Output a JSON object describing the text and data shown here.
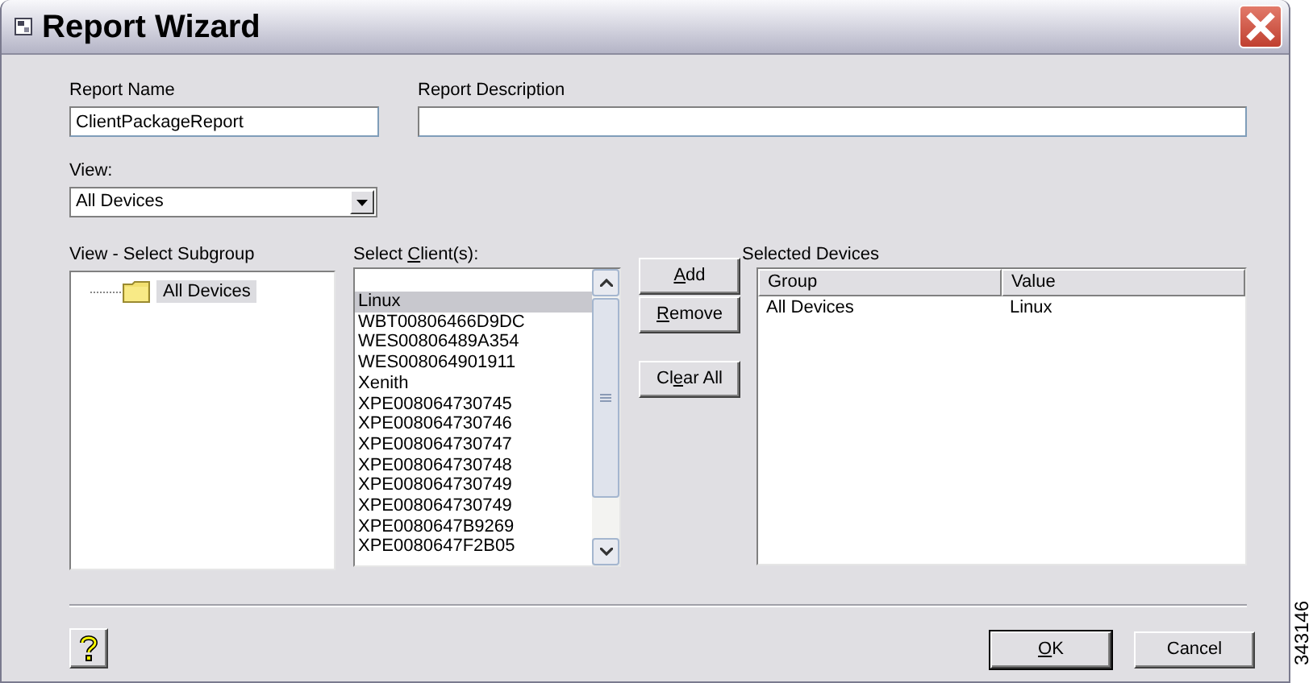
{
  "window": {
    "title": "Report Wizard"
  },
  "report_name": {
    "label": "Report Name",
    "value": "ClientPackageReport"
  },
  "report_description": {
    "label": "Report Description"
  },
  "view": {
    "label": "View:",
    "value": "All Devices"
  },
  "subgroup": {
    "label": "View - Select Subgroup",
    "tree": [
      {
        "label": "All Devices",
        "selected": true
      }
    ]
  },
  "clients": {
    "label": {
      "pre": "Select ",
      "key": "C",
      "post": "lient(s):"
    },
    "items": [
      {
        "label": "Linux",
        "selected": true
      },
      {
        "label": "WBT00806466D9DC",
        "selected": false
      },
      {
        "label": "WES00806489A354",
        "selected": false
      },
      {
        "label": "WES008064901911",
        "selected": false
      },
      {
        "label": "Xenith",
        "selected": false
      },
      {
        "label": "XPE008064730745",
        "selected": false
      },
      {
        "label": "XPE008064730746",
        "selected": false
      },
      {
        "label": "XPE008064730747",
        "selected": false
      },
      {
        "label": "XPE008064730748",
        "selected": false
      },
      {
        "label": "XPE008064730749",
        "selected": false
      },
      {
        "label": "XPE008064730749",
        "selected": false
      },
      {
        "label": "XPE0080647B9269",
        "selected": false
      },
      {
        "label": "XPE0080647F2B05",
        "selected": false
      }
    ]
  },
  "actions": [
    {
      "key": "A",
      "post": "dd"
    },
    {
      "key": "R",
      "post": "emove"
    },
    {
      "pre": "Cl",
      "key": "e",
      "post": "ar All"
    }
  ],
  "selected_devices": {
    "label": "Selected Devices",
    "columns": [
      "Group",
      "Value"
    ],
    "rows": [
      [
        "All Devices",
        "Linux"
      ]
    ]
  },
  "footer_buttons": [
    {
      "key": "O",
      "post": "K",
      "default": true
    },
    {
      "post": "Cancel",
      "default": false
    }
  ],
  "figure_id": "343146"
}
